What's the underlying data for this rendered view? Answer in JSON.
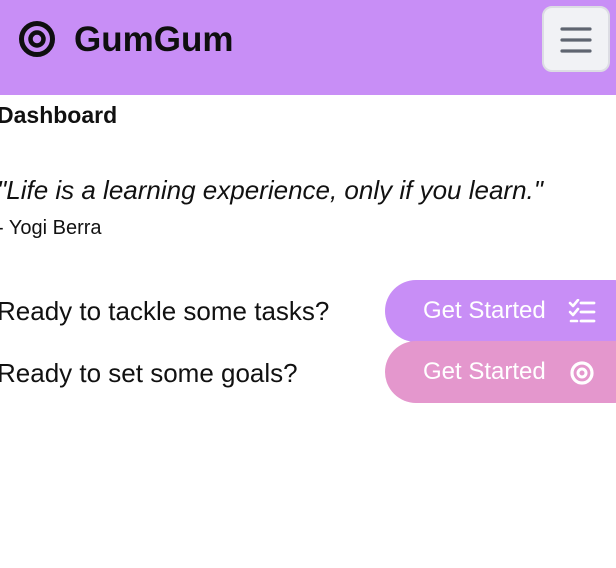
{
  "header": {
    "logo_icon": "target-icon",
    "app_title": "GumGum",
    "menu_icon": "hamburger-menu-icon",
    "background_color": "#c88ef6"
  },
  "main": {
    "page_title": "Dashboard",
    "quote": {
      "text": "\"Life is a learning experience, only if you learn.\"",
      "author": "- Yogi Berra"
    },
    "actions": [
      {
        "prompt": "Ready to tackle some tasks?",
        "button_label": "Get Started",
        "icon": "task-checklist-icon",
        "color": "#c88ef6"
      },
      {
        "prompt": "Ready to set some goals?",
        "button_label": "Get Started",
        "icon": "target-icon",
        "color": "#e497cd"
      }
    ]
  }
}
